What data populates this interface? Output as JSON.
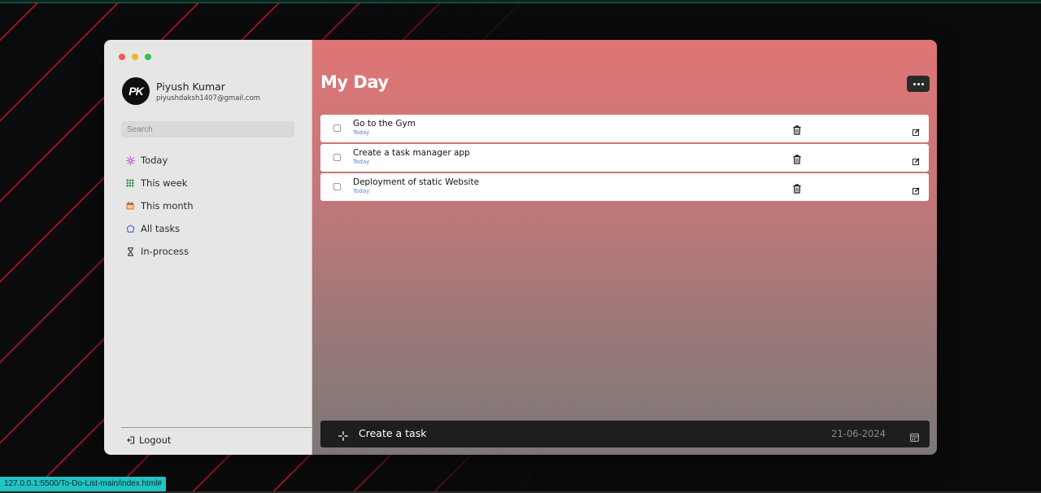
{
  "profile": {
    "name": "Piyush Kumar",
    "email": "piyushdaksh1407@gmail.com",
    "avatar_initials": "PK"
  },
  "search": {
    "placeholder": "Search"
  },
  "sidebar": {
    "items": [
      {
        "label": "Today",
        "icon": "sun-icon",
        "color": "#b63bd2"
      },
      {
        "label": "This week",
        "icon": "table-grid-icon",
        "color": "#3a9b5a"
      },
      {
        "label": "This month",
        "icon": "calendar-icon",
        "color": "#d06a1f"
      },
      {
        "label": "All tasks",
        "icon": "puzzle-icon",
        "color": "#4a58d6"
      },
      {
        "label": "In-process",
        "icon": "hourglass-icon",
        "color": "#333333"
      }
    ],
    "logout_label": "Logout"
  },
  "main": {
    "title": "My Day",
    "tasks": [
      {
        "name": "Go to the Gym",
        "date": "Today",
        "completed": false
      },
      {
        "name": "Create a task manager app",
        "date": "Today",
        "completed": false
      },
      {
        "name": "Deployment of static Website",
        "date": "Today",
        "completed": false
      }
    ],
    "create": {
      "label": "Create a task",
      "date": "21-06-2024"
    }
  },
  "status_url": "127.0.0.1:5500/To-Do-List-main/index.html#",
  "colors": {
    "gradient_top": "#e07575",
    "gradient_bottom": "#7c7777",
    "sidebar_bg": "#e6e6e6",
    "create_bar_bg": "#1e1e1e",
    "status_bar_bg": "#22c3c3"
  }
}
